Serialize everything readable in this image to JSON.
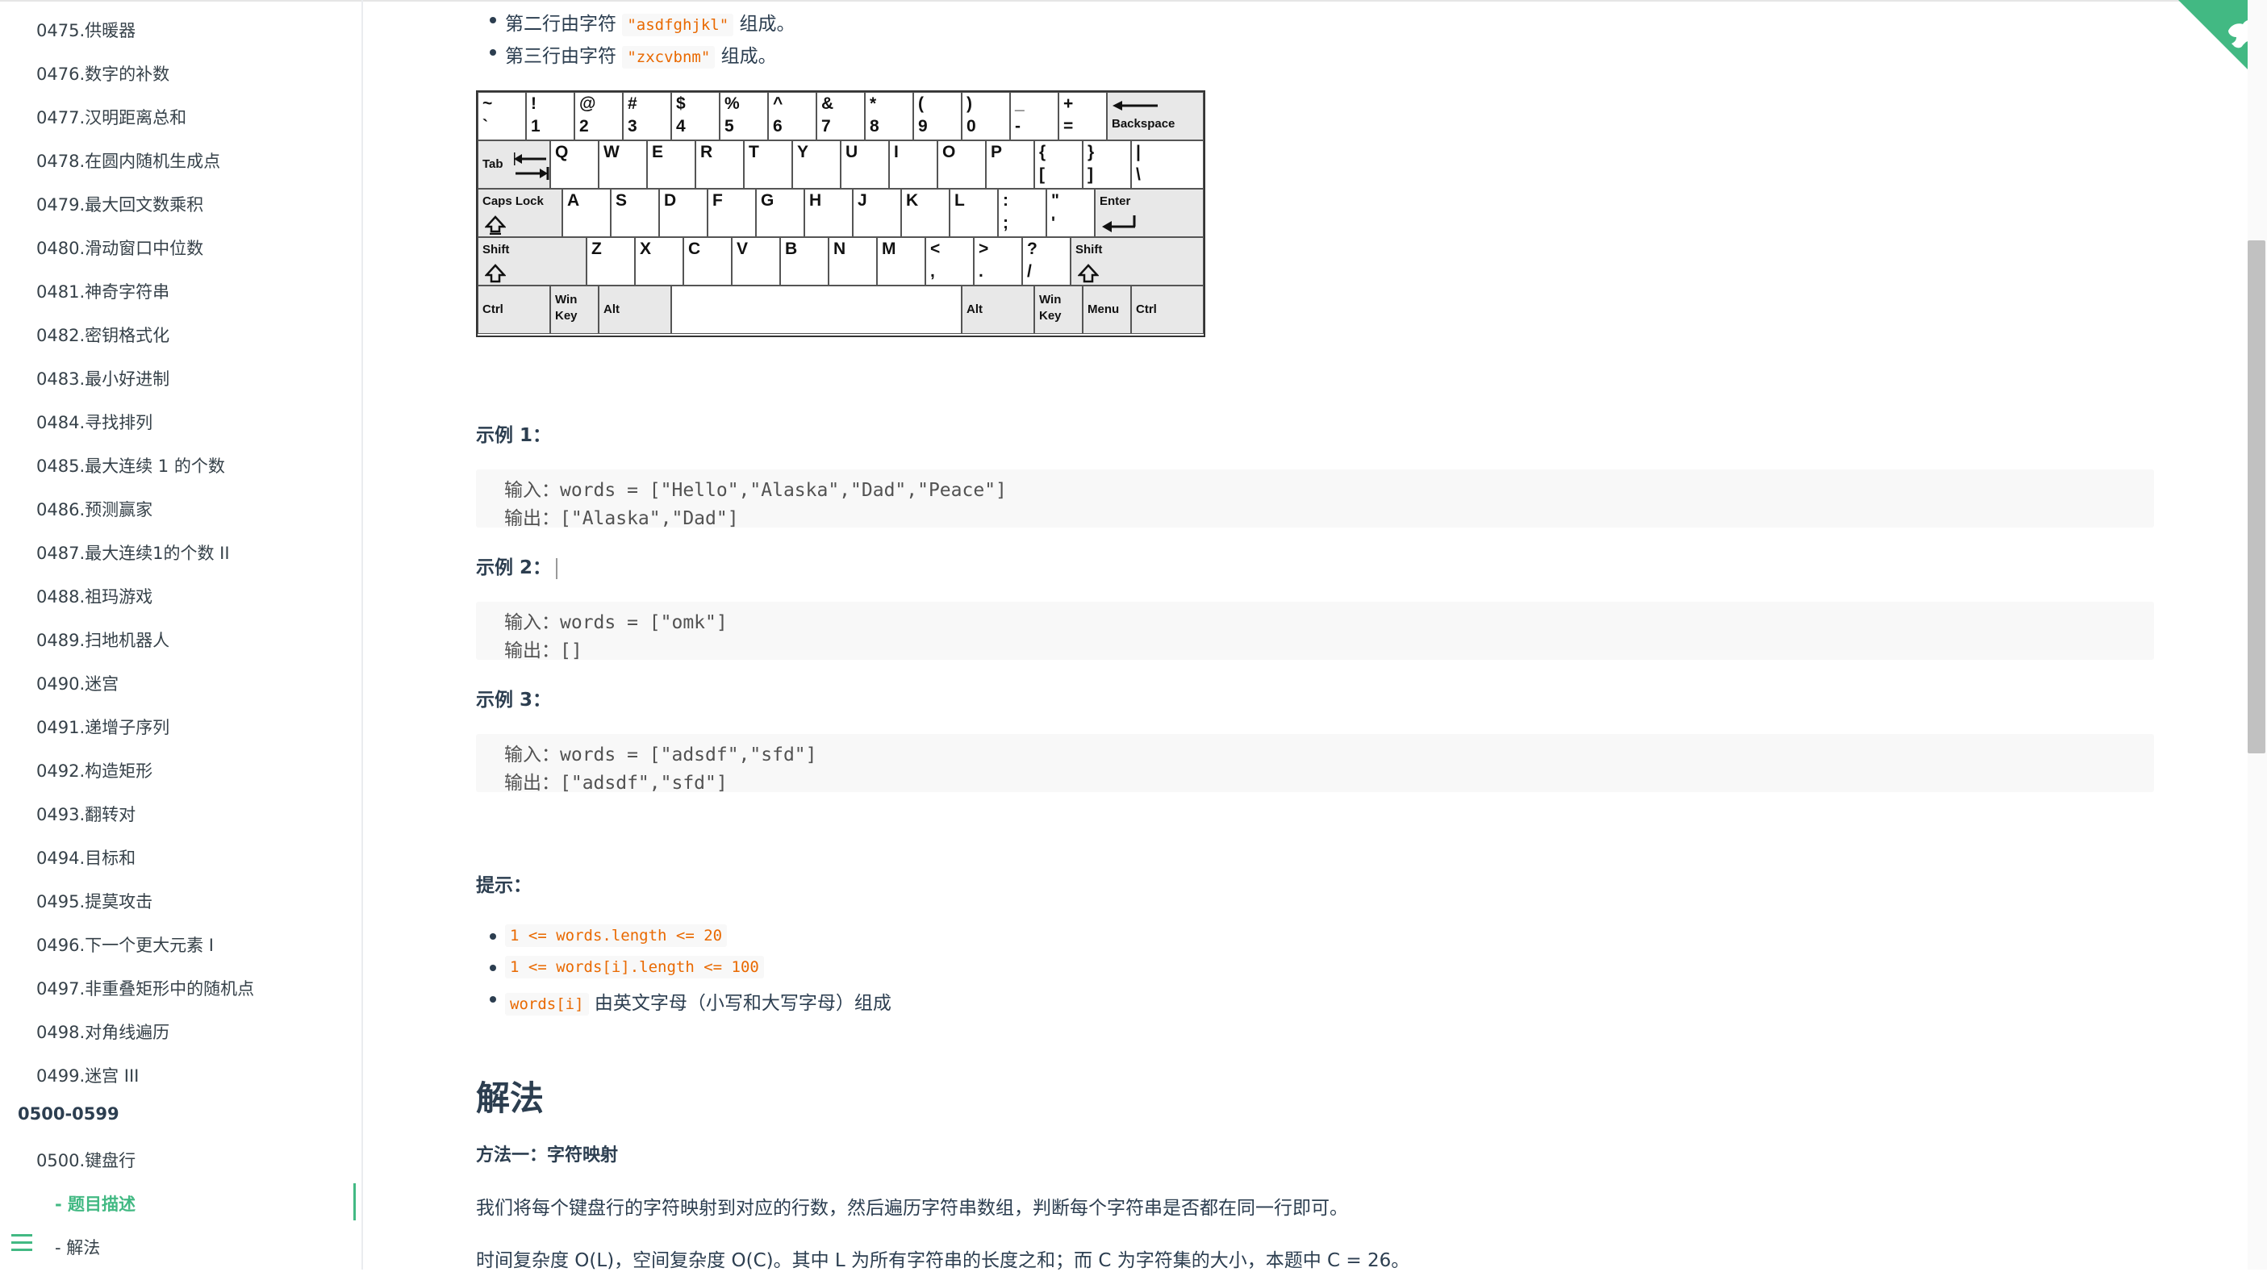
{
  "sidebar": {
    "items": [
      "0475.供暖器",
      "0476.数字的补数",
      "0477.汉明距离总和",
      "0478.在圆内随机生成点",
      "0479.最大回文数乘积",
      "0480.滑动窗口中位数",
      "0481.神奇字符串",
      "0482.密钥格式化",
      "0483.最小好进制",
      "0484.寻找排列",
      "0485.最大连续 1 的个数",
      "0486.预测赢家",
      "0487.最大连续1的个数 II",
      "0488.祖玛游戏",
      "0489.扫地机器人",
      "0490.迷宫",
      "0491.递增子序列",
      "0492.构造矩形",
      "0493.翻转对",
      "0494.目标和",
      "0495.提莫攻击",
      "0496.下一个更大元素 I",
      "0497.非重叠矩形中的随机点",
      "0498.对角线遍历",
      "0499.迷宫 III"
    ],
    "section": "0500-0599",
    "current": "0500.键盘行",
    "sub_active": "- 题目描述",
    "sub_next": "- 解法"
  },
  "content": {
    "row2": {
      "pre": "第二行由字符 ",
      "code": "\"asdfghjkl\"",
      "post": " 组成。"
    },
    "row3": {
      "pre": "第三行由字符 ",
      "code": "\"zxcvbnm\"",
      "post": " 组成。"
    },
    "ex1_title": "示例 1：",
    "ex1_input": "输入：words = [\"Hello\",\"Alaska\",\"Dad\",\"Peace\"]",
    "ex1_output": "输出：[\"Alaska\",\"Dad\"]",
    "ex2_title": "示例 2：",
    "ex2_input": "输入：words = [\"omk\"]",
    "ex2_output": "输出：[]",
    "ex3_title": "示例 3：",
    "ex3_input": "输入：words = [\"adsdf\",\"sfd\"]",
    "ex3_output": "输出：[\"adsdf\",\"sfd\"]",
    "hint_title": "提示：",
    "hint1": "1 <= words.length <= 20",
    "hint2": "1 <= words[i].length <= 100",
    "hint3_code": "words[i]",
    "hint3_text": " 由英文字母（小写和大写字母）组成",
    "solution_title": "解法",
    "method_title": "方法一：字符映射",
    "method_desc": "我们将每个键盘行的字符映射到对应的行数，然后遍历字符串数组，判断每个字符串是否都在同一行即可。",
    "complexity": "时间复杂度 O(L)，空间复杂度 O(C)。其中 L 为所有字符串的长度之和；而 C 为字符集的大小，本题中 C = 26。"
  },
  "keyboard": {
    "row1": [
      [
        "~",
        "`"
      ],
      [
        "!",
        "1"
      ],
      [
        "@",
        "2"
      ],
      [
        "#",
        "3"
      ],
      [
        "$",
        "4"
      ],
      [
        "%",
        "5"
      ],
      [
        "^",
        "6"
      ],
      [
        "&",
        "7"
      ],
      [
        "*",
        "8"
      ],
      [
        "(",
        "9"
      ],
      [
        ")",
        "0"
      ],
      [
        "_",
        "-"
      ],
      [
        "+",
        "="
      ]
    ],
    "backspace": "Backspace",
    "tab": "Tab",
    "row2": [
      "Q",
      "W",
      "E",
      "R",
      "T",
      "Y",
      "U",
      "I",
      "O",
      "P"
    ],
    "row2_sym": [
      [
        "{",
        "["
      ],
      [
        "}",
        "]"
      ],
      [
        "|",
        "\\"
      ]
    ],
    "caps": "Caps Lock",
    "row3": [
      "A",
      "S",
      "D",
      "F",
      "G",
      "H",
      "J",
      "K",
      "L"
    ],
    "row3_sym": [
      [
        ":",
        ";"
      ],
      [
        "\"",
        "'"
      ]
    ],
    "enter": "Enter",
    "shift": "Shift",
    "row4": [
      "Z",
      "X",
      "C",
      "V",
      "B",
      "N",
      "M"
    ],
    "row4_sym": [
      [
        "<",
        ","
      ],
      [
        ">",
        "."
      ],
      [
        "?",
        "/"
      ]
    ],
    "ctrl": "Ctrl",
    "win_top": "Win",
    "win_bottom": "Key",
    "alt": "Alt",
    "menu": "Menu"
  }
}
